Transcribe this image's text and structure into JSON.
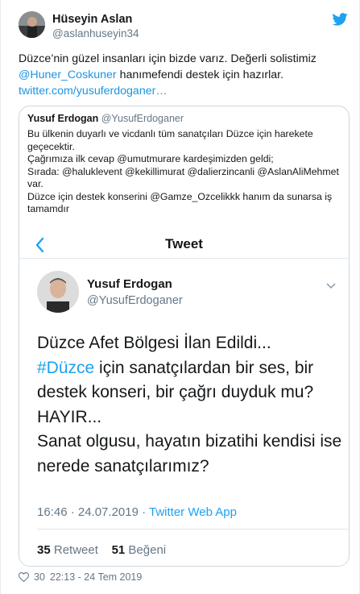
{
  "tweet": {
    "author_name": "Hüseyin Aslan",
    "author_handle": "@aslanhuseyin34",
    "text_part1": "Düzce’nin güzel insanları için bizde varız. Değerli solistimiz",
    "mention": "@Huner_Coskuner",
    "text_part2": " hanımefendi destek için hazırlar.",
    "link": "twitter.com/yusuferdoganer…",
    "likes": "30",
    "timestamp": "22:13 - 24 Tem 2019"
  },
  "quoted": {
    "author_name": "Yusuf Erdogan",
    "author_handle": "@YusufErdoganer",
    "lines": [
      "Bu ülkenin duyarlı ve vicdanlı tüm sanatçıları Düzce için harekete geçecektir.",
      "Çağrımıza ilk cevap @umutmurare kardeşimizden geldi;",
      "Sırada: @haluklevent @kekillimurat @dalierzincanli @AslanAliMehmet var.",
      "Düzce için destek konserini @Gamze_Ozcelikkk hanım da sunarsa iş tamamdır"
    ]
  },
  "screenshot": {
    "header_title": "Tweet",
    "author_name": "Yusuf Erdogan",
    "author_handle": "@YusufErdoganer",
    "line1": "Düzce Afet Bölgesi İlan Edildi...",
    "hashtag": "#Düzce",
    "line2_rest": " için sanatçılardan bir ses, bir destek konseri, bir çağrı duyduk mu? HAYIR...",
    "line3": "Sanat olgusu, hayatın bizatihi kendisi ise nerede sanatçılarımız?",
    "time_date": "16:46 · 24.07.2019 · ",
    "app": "Twitter Web App",
    "retweet_count": "35",
    "retweet_label": "Retweet",
    "like_count": "51",
    "like_label": "Beğeni"
  },
  "colors": {
    "accent": "#1da1f2",
    "link": "#1b95e0",
    "muted": "#657786"
  }
}
